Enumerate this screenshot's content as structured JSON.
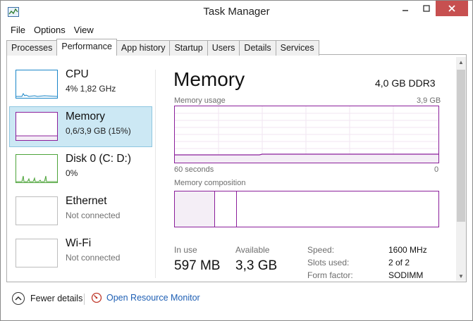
{
  "window": {
    "title": "Task Manager",
    "controls": {
      "minimize": "—",
      "maximize": "□",
      "close": "✕"
    }
  },
  "menu": [
    {
      "label": "File"
    },
    {
      "label": "Options"
    },
    {
      "label": "View"
    }
  ],
  "tabs": [
    {
      "label": "Processes",
      "active": false
    },
    {
      "label": "Performance",
      "active": true
    },
    {
      "label": "App history",
      "active": false
    },
    {
      "label": "Startup",
      "active": false
    },
    {
      "label": "Users",
      "active": false
    },
    {
      "label": "Details",
      "active": false
    },
    {
      "label": "Services",
      "active": false
    }
  ],
  "sidebar": {
    "items": [
      {
        "name": "CPU",
        "detail": "4% 1,82 GHz",
        "color": "#1a86c8"
      },
      {
        "name": "Memory",
        "detail": "0,6/3,9 GB (15%)",
        "color": "#8b1f9b"
      },
      {
        "name": "Disk 0 (C: D:)",
        "detail": "0%",
        "color": "#4da33a"
      },
      {
        "name": "Ethernet",
        "detail": "Not connected",
        "color": "#bdbdbd"
      },
      {
        "name": "Wi-Fi",
        "detail": "Not connected",
        "color": "#bdbdbd"
      }
    ]
  },
  "memory": {
    "title": "Memory",
    "spec": "4,0 GB DDR3",
    "usage_label": "Memory usage",
    "usage_max": "3,9 GB",
    "time_left": "60 seconds",
    "time_right": "0",
    "composition_label": "Memory composition",
    "in_use_label": "In use",
    "in_use_value": "597 MB",
    "available_label": "Available",
    "available_value": "3,3 GB",
    "details": [
      {
        "label": "Speed:",
        "value": "1600 MHz"
      },
      {
        "label": "Slots used:",
        "value": "2 of 2"
      },
      {
        "label": "Form factor:",
        "value": "SODIMM"
      }
    ]
  },
  "footer": {
    "fewer_details": "Fewer details",
    "resource_monitor": "Open Resource Monitor"
  },
  "colors": {
    "memory_accent": "#8b1f9b",
    "selected_bg": "#cce8f4",
    "link": "#1e5fb4",
    "close_button": "#c75050"
  }
}
